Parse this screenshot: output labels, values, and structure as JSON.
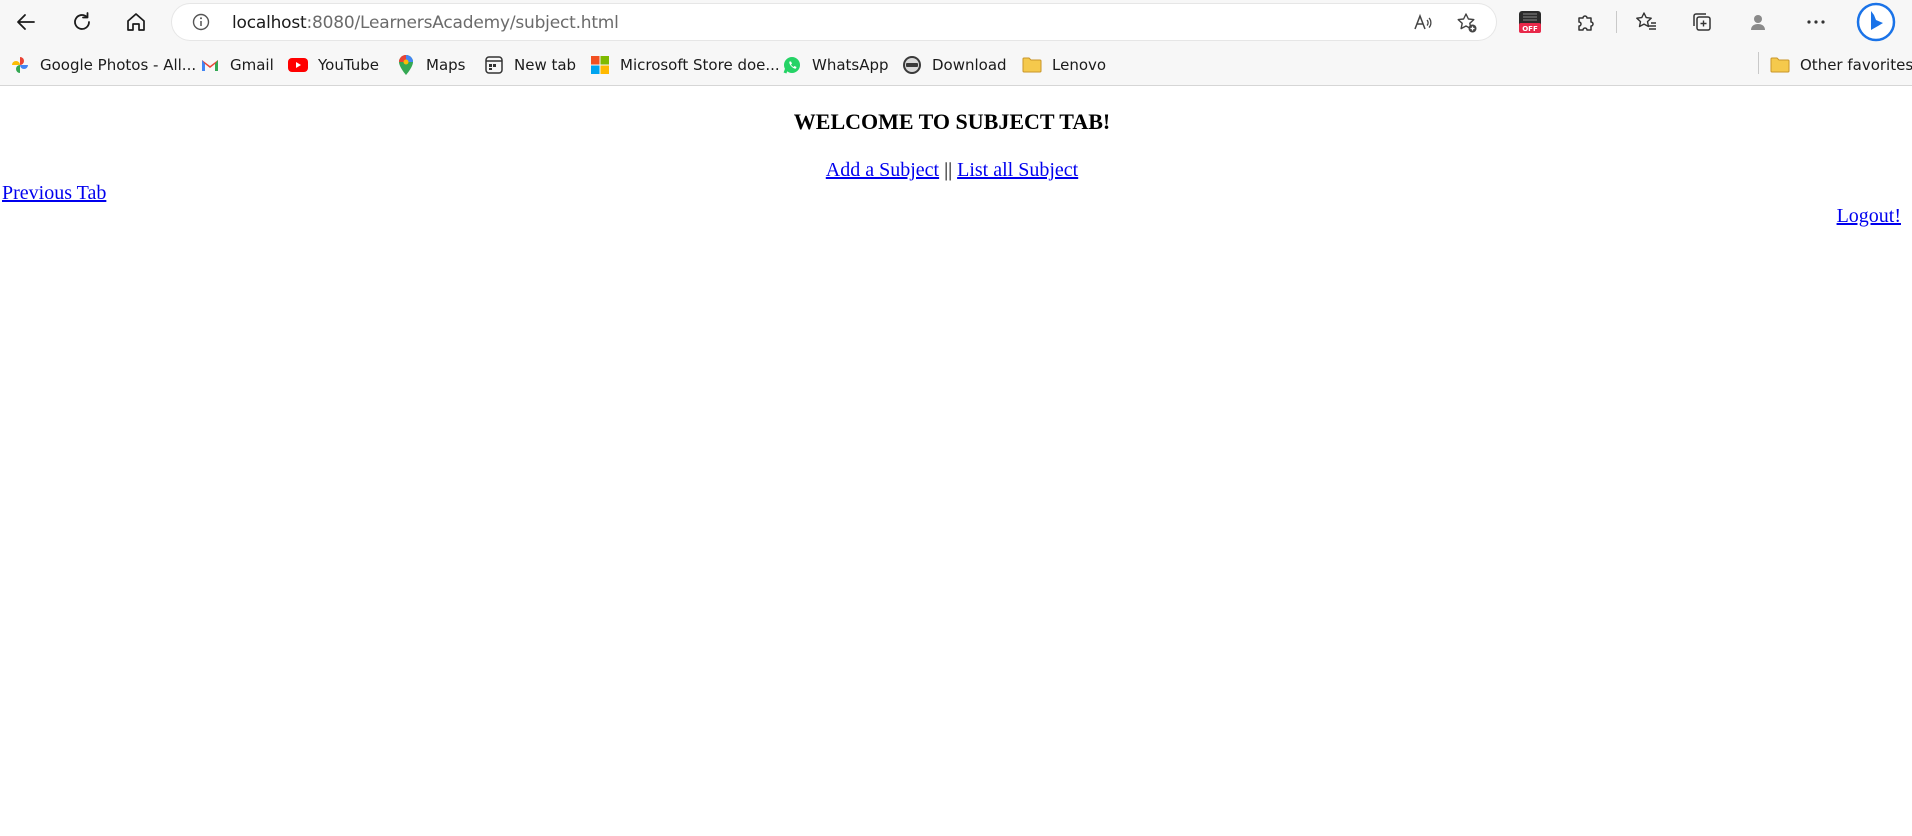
{
  "browser": {
    "url_host": "localhost",
    "url_rest": ":8080/LearnersAcademy/subject.html",
    "extension_badge": "OFF"
  },
  "favorites": [
    {
      "label": "Google Photos - All...",
      "icon": "google-photos-icon"
    },
    {
      "label": "Gmail",
      "icon": "gmail-icon"
    },
    {
      "label": "YouTube",
      "icon": "youtube-icon"
    },
    {
      "label": "Maps",
      "icon": "maps-icon"
    },
    {
      "label": "New tab",
      "icon": "new-tab-icon"
    },
    {
      "label": "Microsoft Store doe...",
      "icon": "microsoft-store-icon"
    },
    {
      "label": "WhatsApp",
      "icon": "whatsapp-icon"
    },
    {
      "label": "Download",
      "icon": "download-icon"
    },
    {
      "label": "Lenovo",
      "icon": "folder-icon"
    }
  ],
  "other_favorites": "Other favorites",
  "page": {
    "heading": "WELCOME TO SUBJECT TAB!",
    "add_subject": "Add a Subject",
    "separator": " || ",
    "list_subject": "List all Subject",
    "previous_tab": "Previous Tab",
    "logout": "Logout!"
  },
  "colors": {
    "link": "#0000ee",
    "toolbar_bg": "#f7f7f7"
  }
}
